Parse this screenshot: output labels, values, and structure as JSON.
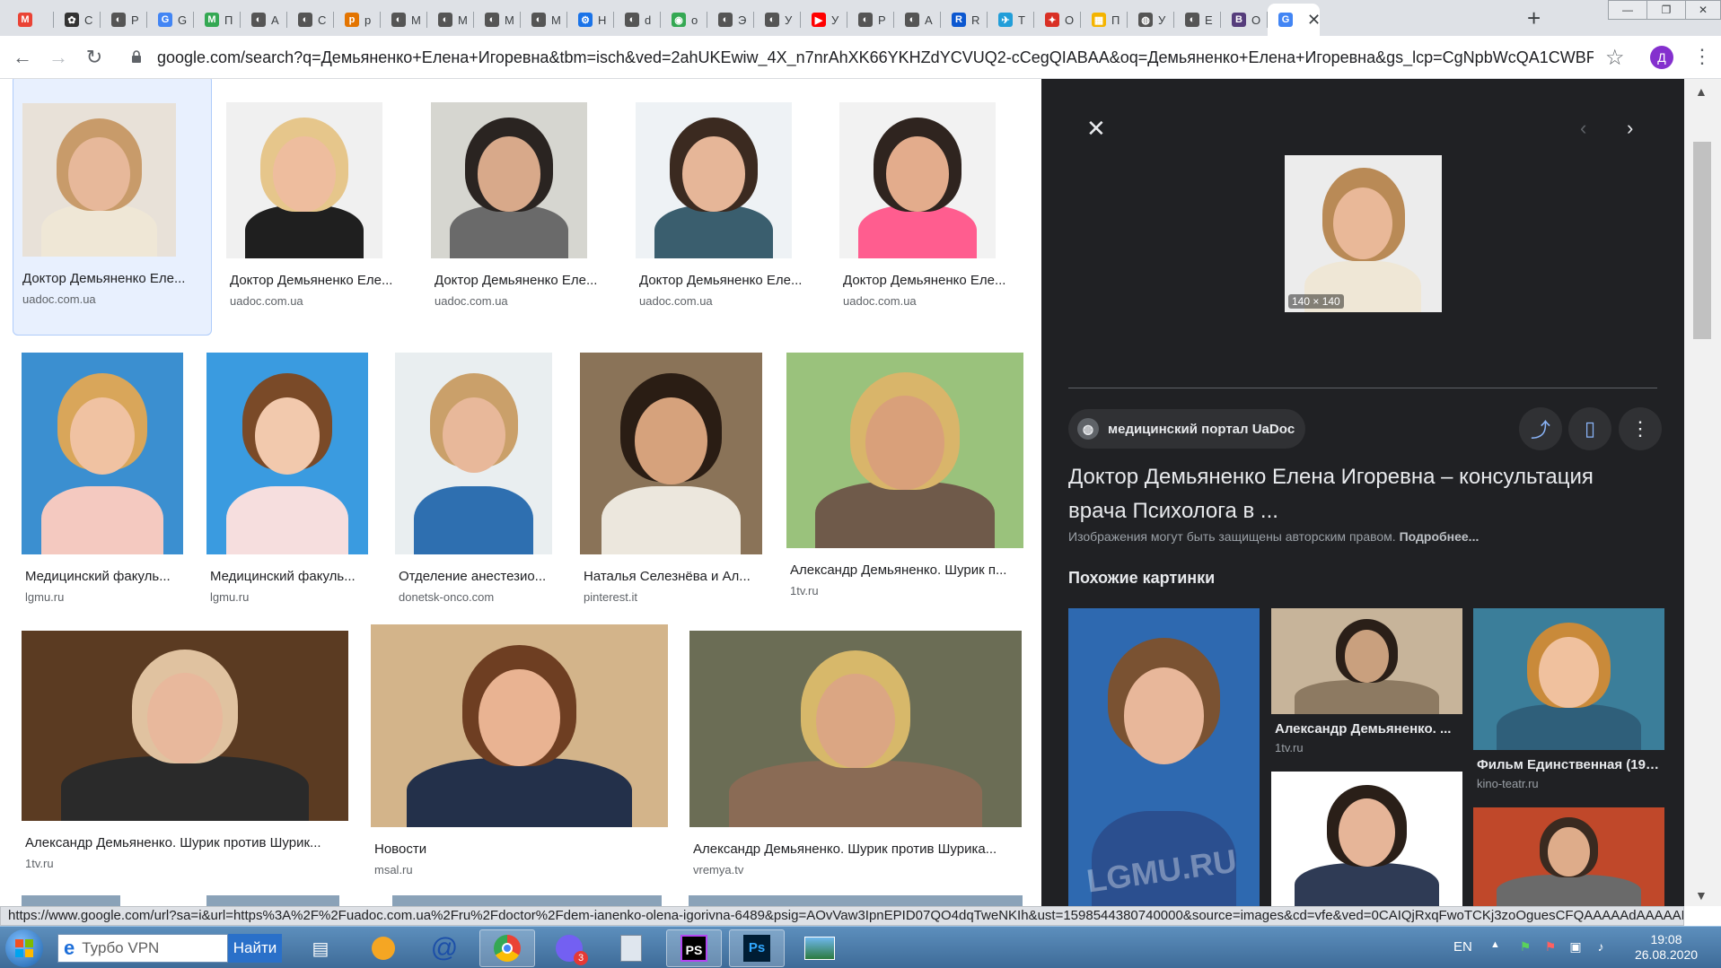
{
  "browser": {
    "tabs": [
      {
        "label": "",
        "favicon_color": "#ea4335",
        "favicon_text": "M"
      },
      {
        "label": "С",
        "favicon_color": "#333333",
        "favicon_text": "✿"
      },
      {
        "label": "Р",
        "favicon_color": "#555555",
        "favicon_text": "◐"
      },
      {
        "label": "G",
        "favicon_color": "#4285f4",
        "favicon_text": "G"
      },
      {
        "label": "П",
        "favicon_color": "#34a853",
        "favicon_text": "M"
      },
      {
        "label": "А",
        "favicon_color": "#555555",
        "favicon_text": "◐"
      },
      {
        "label": "С",
        "favicon_color": "#555555",
        "favicon_text": "◐"
      },
      {
        "label": "p",
        "favicon_color": "#e37400",
        "favicon_text": "p"
      },
      {
        "label": "М",
        "favicon_color": "#555555",
        "favicon_text": "◐"
      },
      {
        "label": "М",
        "favicon_color": "#555555",
        "favicon_text": "◐"
      },
      {
        "label": "М",
        "favicon_color": "#555555",
        "favicon_text": "◐"
      },
      {
        "label": "М",
        "favicon_color": "#555555",
        "favicon_text": "◐"
      },
      {
        "label": "Н",
        "favicon_color": "#1a73e8",
        "favicon_text": "⚙"
      },
      {
        "label": "d",
        "favicon_color": "#555555",
        "favicon_text": "◐"
      },
      {
        "label": "o",
        "favicon_color": "#34a853",
        "favicon_text": "◉"
      },
      {
        "label": "Э",
        "favicon_color": "#555555",
        "favicon_text": "◐"
      },
      {
        "label": "У",
        "favicon_color": "#555555",
        "favicon_text": "◐"
      },
      {
        "label": "У",
        "favicon_color": "#ff0000",
        "favicon_text": "▶"
      },
      {
        "label": "Р",
        "favicon_color": "#555555",
        "favicon_text": "◐"
      },
      {
        "label": "А",
        "favicon_color": "#555555",
        "favicon_text": "◐"
      },
      {
        "label": "R",
        "favicon_color": "#0b57d0",
        "favicon_text": "R"
      },
      {
        "label": "Т",
        "favicon_color": "#229ed9",
        "favicon_text": "✈"
      },
      {
        "label": "О",
        "favicon_color": "#d93025",
        "favicon_text": "✦"
      },
      {
        "label": "П",
        "favicon_color": "#f4b400",
        "favicon_text": "▦"
      },
      {
        "label": "У",
        "favicon_color": "#555555",
        "favicon_text": "◍"
      },
      {
        "label": "Е",
        "favicon_color": "#555555",
        "favicon_text": "◐"
      },
      {
        "label": "О",
        "favicon_color": "#563d7c",
        "favicon_text": "B"
      },
      {
        "label": "",
        "favicon_color": "#4285f4",
        "favicon_text": "G"
      }
    ],
    "new_tab": "+",
    "window_controls": [
      "—",
      "❐",
      "✕"
    ],
    "url": "google.com/search?q=Демьяненко+Елена+Игоревна&tbm=isch&ved=2ahUKEwiw_4X_n7nrAhXK66YKHZdYCVUQ2-cCegQIABAA&oq=Демьяненко+Елена+Игоревна&gs_lcp=CgNpbWcQA1CWBFiWBG...",
    "profile_initial": "Д",
    "status_url": "https://www.google.com/url?sa=i&url=https%3A%2F%2Fuadoc.com.ua%2Fru%2Fdoctor%2Fdem-ianenko-olena-igorivna-6489&psig=AOvVaw3IpnEPID07QO4dqTweNKIh&ust=1598544380740000&source=images&cd=vfe&ved=0CAIQjRxqFwoTCKj3zoOguesCFQAAAAAdAAAAAB..."
  },
  "results": [
    {
      "caption": "Доктор Демьяненко Еле...",
      "domain": "uadoc.com.ua"
    },
    {
      "caption": "Доктор Демьяненко Еле...",
      "domain": "uadoc.com.ua"
    },
    {
      "caption": "Доктор Демьяненко Еле...",
      "domain": "uadoc.com.ua"
    },
    {
      "caption": "Доктор Демьяненко Еле...",
      "domain": "uadoc.com.ua"
    },
    {
      "caption": "Доктор Демьяненко Еле...",
      "domain": "uadoc.com.ua"
    },
    {
      "caption": "Медицинский факуль...",
      "domain": "lgmu.ru"
    },
    {
      "caption": "Медицинский факуль...",
      "domain": "lgmu.ru"
    },
    {
      "caption": "Отделение анестезио...",
      "domain": "donetsk-onco.com"
    },
    {
      "caption": "Наталья Селезнёва и Ал...",
      "domain": "pinterest.it"
    },
    {
      "caption": "Александр Демьяненко. Шурик п...",
      "domain": "1tv.ru"
    },
    {
      "caption": "Александр Демьяненко. Шурик против Шурик...",
      "domain": "1tv.ru"
    },
    {
      "caption": "Новости",
      "domain": "msal.ru"
    },
    {
      "caption": "Александр Демьяненко. Шурик против Шурика...",
      "domain": "vremya.tv"
    }
  ],
  "preview": {
    "close": "✕",
    "prev": "‹",
    "next": "›",
    "dimensions": "140 × 140",
    "source": "медицинский портал UaDoc",
    "title": "Доктор Демьяненко Елена Игоревна – консультация врача Психолога в ...",
    "copyright": "Изображения могут быть защищены авторским правом.",
    "copyright_link": "Подробнее...",
    "similar_heading": "Похожие картинки",
    "similar": [
      {
        "caption": "",
        "domain": ""
      },
      {
        "caption": "Александр Демьяненко. ...",
        "domain": "1tv.ru"
      },
      {
        "caption": "Фильм Единственная (197...",
        "domain": "kino-teatr.ru"
      },
      {
        "caption": "",
        "domain": ""
      },
      {
        "caption": "",
        "domain": ""
      }
    ],
    "watermark": "LGMU.RU"
  },
  "taskbar": {
    "search_text": "Турбо VPN",
    "search_button": "Найти",
    "viber_badge": "3",
    "lang": "EN",
    "time": "19:08",
    "date": "26.08.2020"
  }
}
